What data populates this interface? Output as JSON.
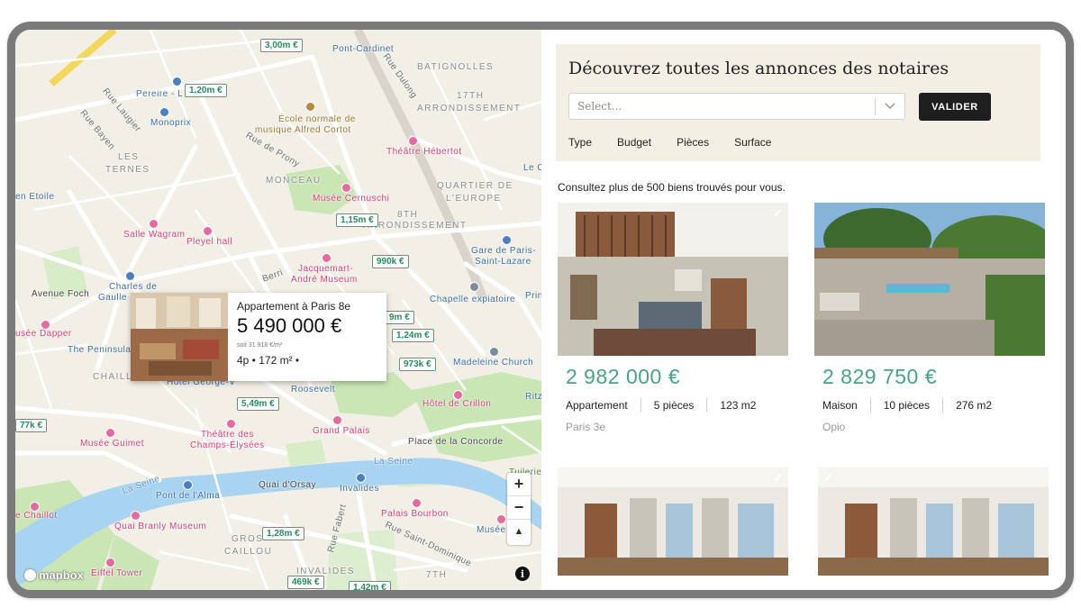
{
  "map": {
    "labels": {
      "pont_cardinet": "Pont-Cardinet",
      "batignolles": "BATIGNOLLES",
      "arr17_a": "17TH",
      "arr17_b": "ARRONDISSEMENT",
      "rue_dulong": "Rue Dulong",
      "pereire": "Pereire - L",
      "monoprix": "Monoprix",
      "rue_laugier": "Rue Laugier",
      "rue_bayen": "Rue Bayen",
      "ecole_a": "École normale de",
      "ecole_b": "musique Alfred Cortot",
      "rue_prony": "Rue de Prony",
      "theatre_hebertot": "Théâtre Hébertot",
      "les_ternes_a": "LES",
      "les_ternes_b": "TERNES",
      "monceau": "MONCEAU",
      "quartier_a": "QUARTIER DE",
      "quartier_b": "L'EUROPE",
      "le_c": "Le C",
      "etoile": "en Etoile",
      "musee_cernuschi": "Musée Cernuschi",
      "arr8_a": "8TH",
      "arr8_b": "ARRONDISSEMENT",
      "salle_wagram": "Salle Wagram",
      "pleyel": "Pleyel hall",
      "gare_a": "Gare de Paris-",
      "gare_b": "Saint-Lazare",
      "jacquemart_a": "Jacquemart-",
      "jacquemart_b": "André Museum",
      "charles_a": "Charles de",
      "charles_b": "Gaulle",
      "avenue_foch": "Avenue Foch",
      "berri": "Berri",
      "chapelle": "Chapelle expiatoire",
      "prin": "Prin",
      "dapper": "usée Dapper",
      "peninsula": "The Peninsula",
      "madeleine": "Madeleine Church",
      "chaillot": "CHAILLOT",
      "george_v": "Hôtel George-V",
      "roosevelt": "Roosevelt",
      "crillon": "Hôtel de Crillon",
      "ritz": "Ritz",
      "guimet": "Musée Guimet",
      "theatre_ce_a": "Théâtre des",
      "theatre_ce_b": "Champs-Élysées",
      "grand_palais": "Grand Palais",
      "concorde": "Place de la Concorde",
      "tuileries": "Tuileries Garc",
      "la_seine": "La Seine",
      "la_seine2": "La Seine",
      "pont_alma": "Pont de l'Alma",
      "quai_orsay": "Quai d'Orsay",
      "invalides": "Invalides",
      "palais_bourbon": "Palais Bourbon",
      "chaillot2": "e Chaillot",
      "branly": "Quai Branly Museum",
      "gros_a": "GROS",
      "gros_b": "CAILLOU",
      "rue_fabert": "Rue Fabert",
      "rue_st_dominique": "Rue Saint-Dominique",
      "musee_o": "Musée O",
      "eiffel": "Eiffel Tower",
      "invalides2": "INVALIDES",
      "arr7": "7TH"
    },
    "price_tags": [
      "3,00m €",
      "1,20m €",
      "1,15m €",
      "990k €",
      "9m €",
      "1,24m €",
      "973k €",
      "5,49m €",
      "77k €",
      "1,28m €",
      "469k €",
      "1,42m €"
    ],
    "popup": {
      "title": "Appartement à Paris 8e",
      "price": "5 490 000 €",
      "sub": "soit 31 918 €/m²",
      "meta": "4p • 172 m² •"
    },
    "controls": {
      "zoom_in": "+",
      "zoom_out": "−",
      "compass": "▲"
    },
    "attribution": {
      "logo": "mapbox",
      "info": "i"
    }
  },
  "panel": {
    "title": "Découvrez toutes les annonces des notaires",
    "select_placeholder": "Select...",
    "submit_label": "VALIDER",
    "filters": [
      "Type",
      "Budget",
      "Pièces",
      "Surface"
    ],
    "results_text": "Consultez plus de 500 biens trouvés pour vous.",
    "listings": [
      {
        "price": "2 982 000 €",
        "type": "Appartement",
        "rooms": "5 pièces",
        "area": "123 m2",
        "location": "Paris 3e"
      },
      {
        "price": "2 829 750 €",
        "type": "Maison",
        "rooms": "10 pièces",
        "area": "276 m2",
        "location": "Opio"
      }
    ]
  },
  "colors": {
    "accent_green": "#4aa380",
    "price_tag_border": "#3aa878",
    "button_bg": "#1e1e1e",
    "search_bg": "#f3efe5"
  }
}
